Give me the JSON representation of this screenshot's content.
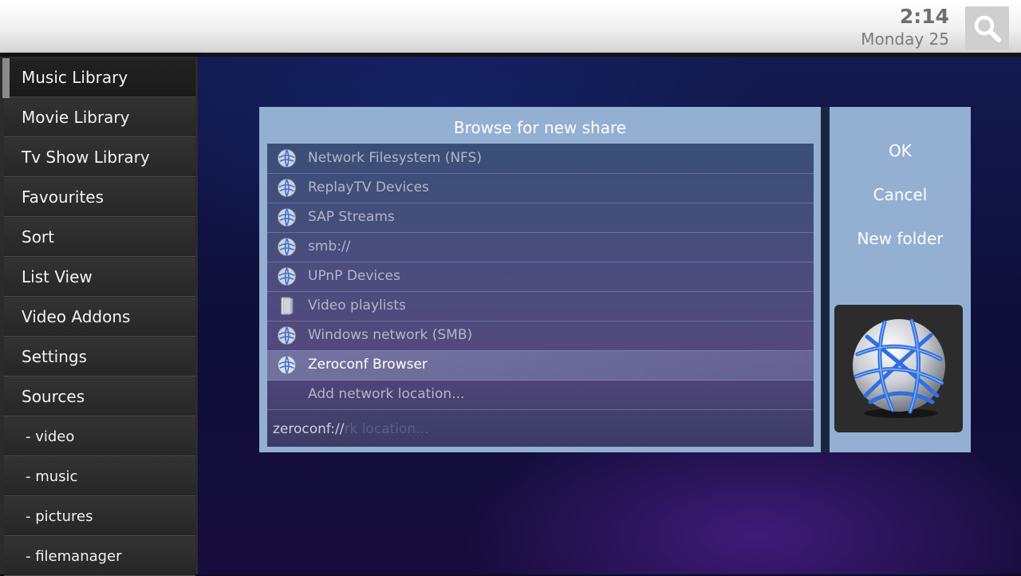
{
  "header": {
    "time": "2:14",
    "date": "Monday 25",
    "search_icon": "search-icon"
  },
  "sidebar": {
    "items": [
      {
        "label": "Music Library"
      },
      {
        "label": "Movie Library"
      },
      {
        "label": "Tv Show Library"
      },
      {
        "label": "Favourites"
      },
      {
        "label": "Sort"
      },
      {
        "label": "List View"
      },
      {
        "label": "Video Addons"
      },
      {
        "label": "Settings"
      },
      {
        "label": "Sources"
      },
      {
        "label": "- video"
      },
      {
        "label": "- music"
      },
      {
        "label": "- pictures"
      },
      {
        "label": "- filemanager"
      }
    ],
    "selected": "Music Library"
  },
  "dialog": {
    "title": "Browse for new share",
    "items": [
      {
        "label": "Network Filesystem (NFS)",
        "icon": "network-globe-icon"
      },
      {
        "label": "ReplayTV Devices",
        "icon": "network-globe-icon"
      },
      {
        "label": "SAP Streams",
        "icon": "network-globe-icon"
      },
      {
        "label": "smb://",
        "icon": "network-globe-icon"
      },
      {
        "label": "UPnP Devices",
        "icon": "network-globe-icon"
      },
      {
        "label": "Video playlists",
        "icon": "folder-icon"
      },
      {
        "label": "Windows network (SMB)",
        "icon": "network-globe-icon"
      },
      {
        "label": "Zeroconf Browser",
        "icon": "network-globe-icon"
      },
      {
        "label": "Add network location...",
        "icon": ""
      }
    ],
    "focused": "Zeroconf Browser",
    "path": "zeroconf://",
    "path_ghost": "rk location..."
  },
  "buttons": {
    "ok": "OK",
    "cancel": "Cancel",
    "new_folder": "New folder"
  },
  "colors": {
    "dialog_bg": "#93b0d3",
    "sidebar_bg": "#2b2b2b",
    "accent_blue": "#2f6fe0"
  }
}
